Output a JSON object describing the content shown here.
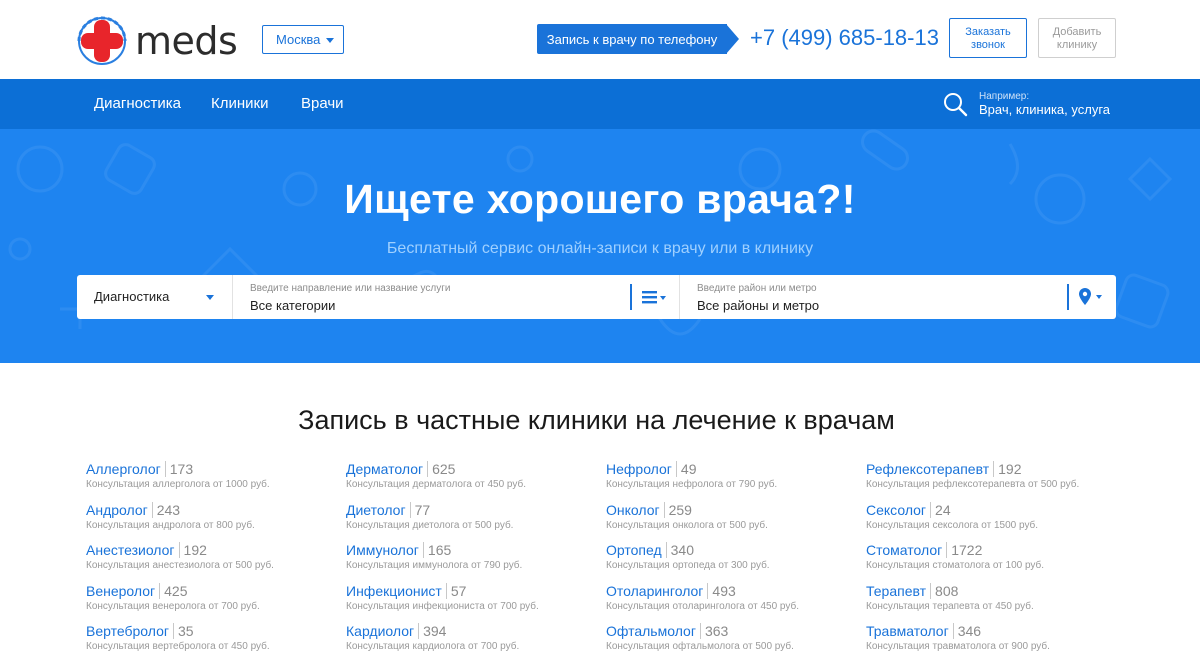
{
  "header": {
    "logo_text": "meds",
    "city": "Москва",
    "phone_cta": "Запись к врачу по телефону",
    "phone": "+7 (499) 685-18-13",
    "order_call": [
      "Заказать",
      "звонок"
    ],
    "add_clinic": [
      "Добавить",
      "клинику"
    ]
  },
  "nav": {
    "items": [
      "Диагностика",
      "Клиники",
      "Врачи"
    ],
    "search_hint_label": "Например:",
    "search_hint_value": "Врач, клиника, услуга"
  },
  "hero": {
    "title": "Ищете хорошего врача?!",
    "subtitle": "Бесплатный сервис онлайн-записи к врачу или в клинику",
    "search_type": "Диагностика",
    "direction_label": "Введите направление или название услуги",
    "direction_value": "Все категории",
    "district_label": "Введите район или метро",
    "district_value": "Все районы и метро"
  },
  "listing": {
    "title": "Запись в частные клиники на лечение к врачам",
    "columns": [
      [
        {
          "name": "Аллерголог",
          "count": "173",
          "desc": "Консультация аллерголога от 1000 руб."
        },
        {
          "name": "Андролог",
          "count": "243",
          "desc": "Консультация андролога от 800 руб."
        },
        {
          "name": "Анестезиолог",
          "count": "192",
          "desc": "Консультация анестезиолога от 500 руб."
        },
        {
          "name": "Венеролог",
          "count": "425",
          "desc": "Консультация венеролога от 700 руб."
        },
        {
          "name": "Вертебролог",
          "count": "35",
          "desc": "Консультация вертебролога от 450 руб."
        }
      ],
      [
        {
          "name": "Дерматолог",
          "count": "625",
          "desc": "Консультация дерматолога от 450 руб."
        },
        {
          "name": "Диетолог",
          "count": "77",
          "desc": "Консультация диетолога от 500 руб."
        },
        {
          "name": "Иммунолог",
          "count": "165",
          "desc": "Консультация иммунолога от 790 руб."
        },
        {
          "name": "Инфекционист",
          "count": "57",
          "desc": "Консультация инфекциониста от 700 руб."
        },
        {
          "name": "Кардиолог",
          "count": "394",
          "desc": "Консультация кардиолога от 700 руб."
        }
      ],
      [
        {
          "name": "Нефролог",
          "count": "49",
          "desc": "Консультация нефролога от 790 руб."
        },
        {
          "name": "Онколог",
          "count": "259",
          "desc": "Консультация онколога от 500 руб."
        },
        {
          "name": "Ортопед",
          "count": "340",
          "desc": "Консультация ортопеда от 300 руб."
        },
        {
          "name": "Отоларинголог",
          "count": "493",
          "desc": "Консультация отоларинголога от 450 руб."
        },
        {
          "name": "Офтальмолог",
          "count": "363",
          "desc": "Консультация офтальмолога от 500 руб."
        }
      ],
      [
        {
          "name": "Рефлексотерапевт",
          "count": "192",
          "desc": "Консультация рефлексотерапевта от 500 руб."
        },
        {
          "name": "Сексолог",
          "count": "24",
          "desc": "Консультация сексолога от 1500 руб."
        },
        {
          "name": "Стоматолог",
          "count": "1722",
          "desc": "Консультация стоматолога от 100 руб."
        },
        {
          "name": "Терапевт",
          "count": "808",
          "desc": "Консультация терапевта от 450 руб."
        },
        {
          "name": "Травматолог",
          "count": "346",
          "desc": "Консультация травматолога от 900 руб."
        }
      ]
    ]
  },
  "icons": {
    "logo": "red-cross-logo-icon",
    "search": "search-icon",
    "list": "list-menu-icon",
    "location": "location-pin-icon"
  },
  "colors": {
    "brand_blue": "#1a73d9",
    "nav_blue": "#0c6fd6",
    "hero_blue": "#1e84f0",
    "logo_red": "#e8252b"
  }
}
